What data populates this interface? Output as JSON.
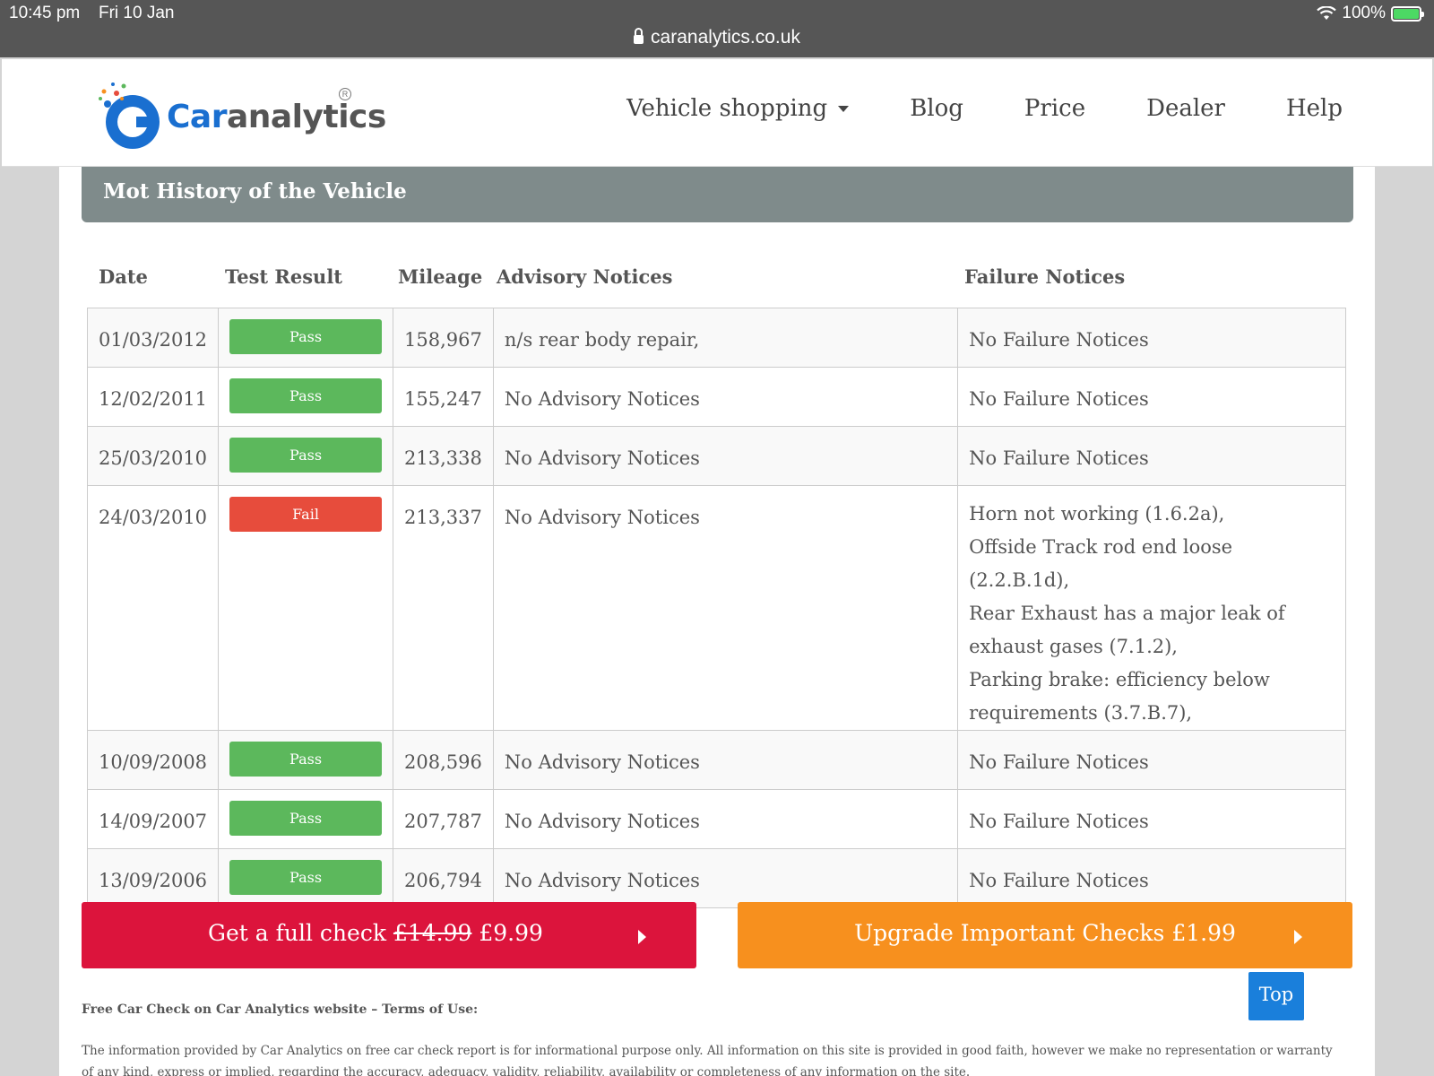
{
  "status_bar": {
    "time": "10:45 pm",
    "date": "Fri 10 Jan",
    "battery": "100%",
    "url": "caranalytics.co.uk"
  },
  "brand": {
    "name_part1": "Car",
    "name_part2": "analytics",
    "registered": "R",
    "accent": "#1a6fd0"
  },
  "nav": {
    "items": [
      "Vehicle shopping",
      "Blog",
      "Price",
      "Dealer",
      "Help"
    ]
  },
  "section": {
    "title": "Mot History of the Vehicle"
  },
  "table": {
    "headers": [
      "Date",
      "Test Result",
      "Mileage",
      "Advisory Notices",
      "Failure Notices"
    ],
    "rows": [
      {
        "date": "01/03/2012",
        "result": "Pass",
        "mileage": "158,967",
        "advisory": "n/s rear body repair,",
        "failure": "No Failure Notices"
      },
      {
        "date": "12/02/2011",
        "result": "Pass",
        "mileage": "155,247",
        "advisory": "No Advisory Notices",
        "failure": "No Failure Notices"
      },
      {
        "date": "25/03/2010",
        "result": "Pass",
        "mileage": "213,338",
        "advisory": "No Advisory Notices",
        "failure": "No Failure Notices"
      },
      {
        "date": "24/03/2010",
        "result": "Fail",
        "mileage": "213,337",
        "advisory": "No Advisory Notices",
        "failure_lines": [
          "Horn not working (1.6.2a),",
          "Offside Track rod end loose (2.2.B.1d),",
          "Rear Exhaust has a major leak of",
          "exhaust gases (7.1.2),",
          "Parking brake: efficiency below",
          "requirements (3.7.B.7),"
        ]
      },
      {
        "date": "10/09/2008",
        "result": "Pass",
        "mileage": "208,596",
        "advisory": "No Advisory Notices",
        "failure": "No Failure Notices"
      },
      {
        "date": "14/09/2007",
        "result": "Pass",
        "mileage": "207,787",
        "advisory": "No Advisory Notices",
        "failure": "No Failure Notices"
      },
      {
        "date": "13/09/2006",
        "result": "Pass",
        "mileage": "206,794",
        "advisory": "No Advisory Notices",
        "failure": "No Failure Notices"
      }
    ]
  },
  "cta": {
    "full_check_prefix": "Get a full check",
    "full_check_old_price": "£14.99",
    "full_check_price": "£9.99",
    "upgrade_label": "Upgrade Important Checks £1.99",
    "top_label": "Top",
    "colors": {
      "red": "#dc143c",
      "orange": "#f7901e",
      "top": "#1a7fdb",
      "pass": "#5cb85c",
      "fail": "#e74c3c"
    }
  },
  "terms": {
    "title": "Free Car Check on Car Analytics website – Terms of Use:",
    "body": "The information provided by Car Analytics on free car check report is for informational purpose only. All information on this site is provided in good faith, however we make no representation or warranty of any kind, express or implied, regarding the accuracy, adequacy, validity, reliability, availability or completeness of any information on the site."
  }
}
